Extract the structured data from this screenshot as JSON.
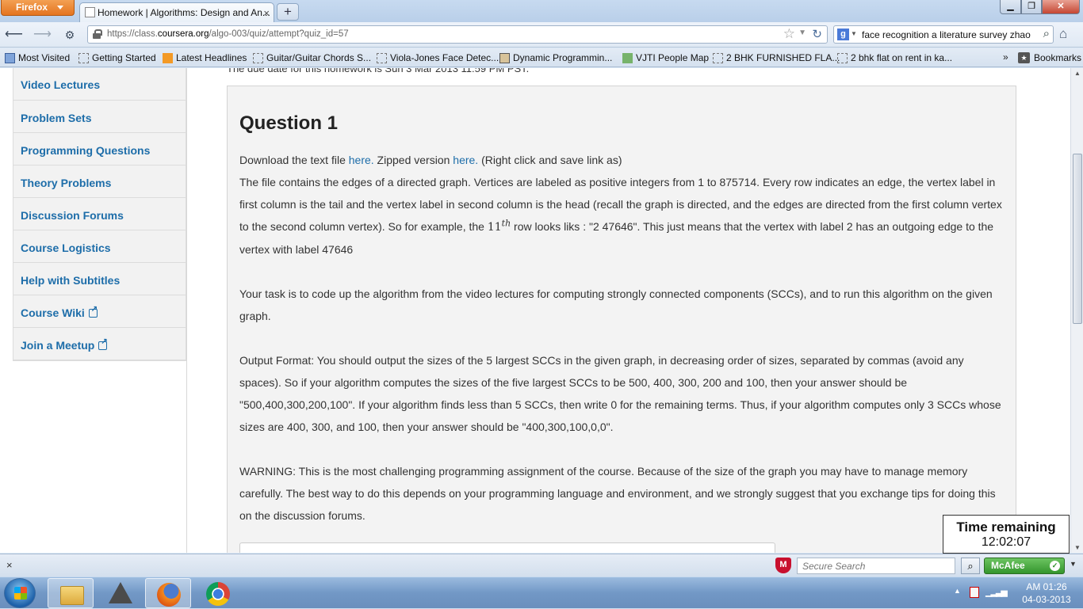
{
  "browser": {
    "app_button": "Firefox",
    "tab_title": "Homework | Algorithms: Design and An...",
    "url_prefix": "https://class.",
    "url_domain": "coursera.org",
    "url_path": "/algo-003/quiz/attempt?quiz_id=57",
    "search_query": "face recognition a literature survey zhao",
    "window_controls": [
      "minimize",
      "maximize",
      "close"
    ]
  },
  "bookmarks": [
    {
      "label": "Most Visited",
      "icon": "page-icon"
    },
    {
      "label": "Getting Started",
      "icon": "page-icon"
    },
    {
      "label": "Latest Headlines",
      "icon": "rss-icon"
    },
    {
      "label": "Guitar/Guitar Chords S...",
      "icon": "page-icon"
    },
    {
      "label": "Viola-Jones Face Detec...",
      "icon": "page-icon"
    },
    {
      "label": "Dynamic Programmin...",
      "icon": "page-icon"
    },
    {
      "label": "VJTI People Map",
      "icon": "map-icon"
    },
    {
      "label": "2 BHK FURNISHED FLA...",
      "icon": "page-icon"
    },
    {
      "label": "2 bhk flat on rent in ka...",
      "icon": "page-icon"
    }
  ],
  "bookmarks_more": "»",
  "bookmarks_menu": "Bookmarks",
  "sidebar": {
    "items": [
      {
        "label": "Video Lectures",
        "external": false
      },
      {
        "label": "Problem Sets",
        "external": false
      },
      {
        "label": "Programming Questions",
        "external": false
      },
      {
        "label": "Theory Problems",
        "external": false
      },
      {
        "label": "Discussion Forums",
        "external": false
      },
      {
        "label": "Course Logistics",
        "external": false
      },
      {
        "label": "Help with Subtitles",
        "external": false
      },
      {
        "label": "Course Wiki",
        "external": true
      },
      {
        "label": "Join a Meetup",
        "external": true
      }
    ]
  },
  "question": {
    "partial_top_line": "The due date for this homework is Sun 3 Mar 2013 11:59 PM PST.",
    "title": "Question 1",
    "download_prefix": "Download the text file ",
    "download_link": "here.",
    "zipped_prefix": " Zipped version ",
    "zipped_link": "here.",
    "download_suffix": " (Right click and save link as)",
    "para1_a": "The file contains the edges of a directed graph. Vertices are labeled as positive integers from 1 to 875714. Every row indicates an edge, the vertex label in first column is the tail and the vertex label in second column is the head (recall the graph is directed, and the edges are directed from the first column vertex to the second column vertex). So for example, the ",
    "para1_num": "11",
    "para1_sup": "th",
    "para1_b": " row looks liks : \"2 47646\". This just means that the vertex with label 2 has an outgoing edge to the vertex with label 47646",
    "para2": "Your task is to code up the algorithm from the video lectures for computing strongly connected components (SCCs), and to run this algorithm on the given graph.",
    "para3": "Output Format: You should output the sizes of the 5 largest SCCs in the given graph, in decreasing order of sizes, separated by commas (avoid any spaces). So if your algorithm computes the sizes of the five largest SCCs to be 500, 400, 300, 200 and 100, then your answer should be \"500,400,300,200,100\". If your algorithm finds less than 5 SCCs, then write 0 for the remaining terms. Thus, if your algorithm computes only 3 SCCs whose sizes are 400, 300, and 100, then your answer should be \"400,300,100,0,0\".",
    "para4": "WARNING: This is the most challenging programming assignment of the course. Because of the size of the graph you may have to manage memory carefully. The best way to do this depends on your programming language and environment, and we strongly suggest that you exchange tips for doing this on the discussion forums."
  },
  "timer": {
    "label": "Time remaining",
    "value": "12:02:07"
  },
  "addon_bar": {
    "close": "×",
    "secure_search_placeholder": "Secure Search",
    "mcafee_label": "McAfee"
  },
  "taskbar": {
    "items": [
      "start-button",
      "explorer",
      "age-of-empires",
      "firefox",
      "chrome"
    ],
    "clock_time": "AM 01:26",
    "clock_date": "04-03-2013"
  }
}
